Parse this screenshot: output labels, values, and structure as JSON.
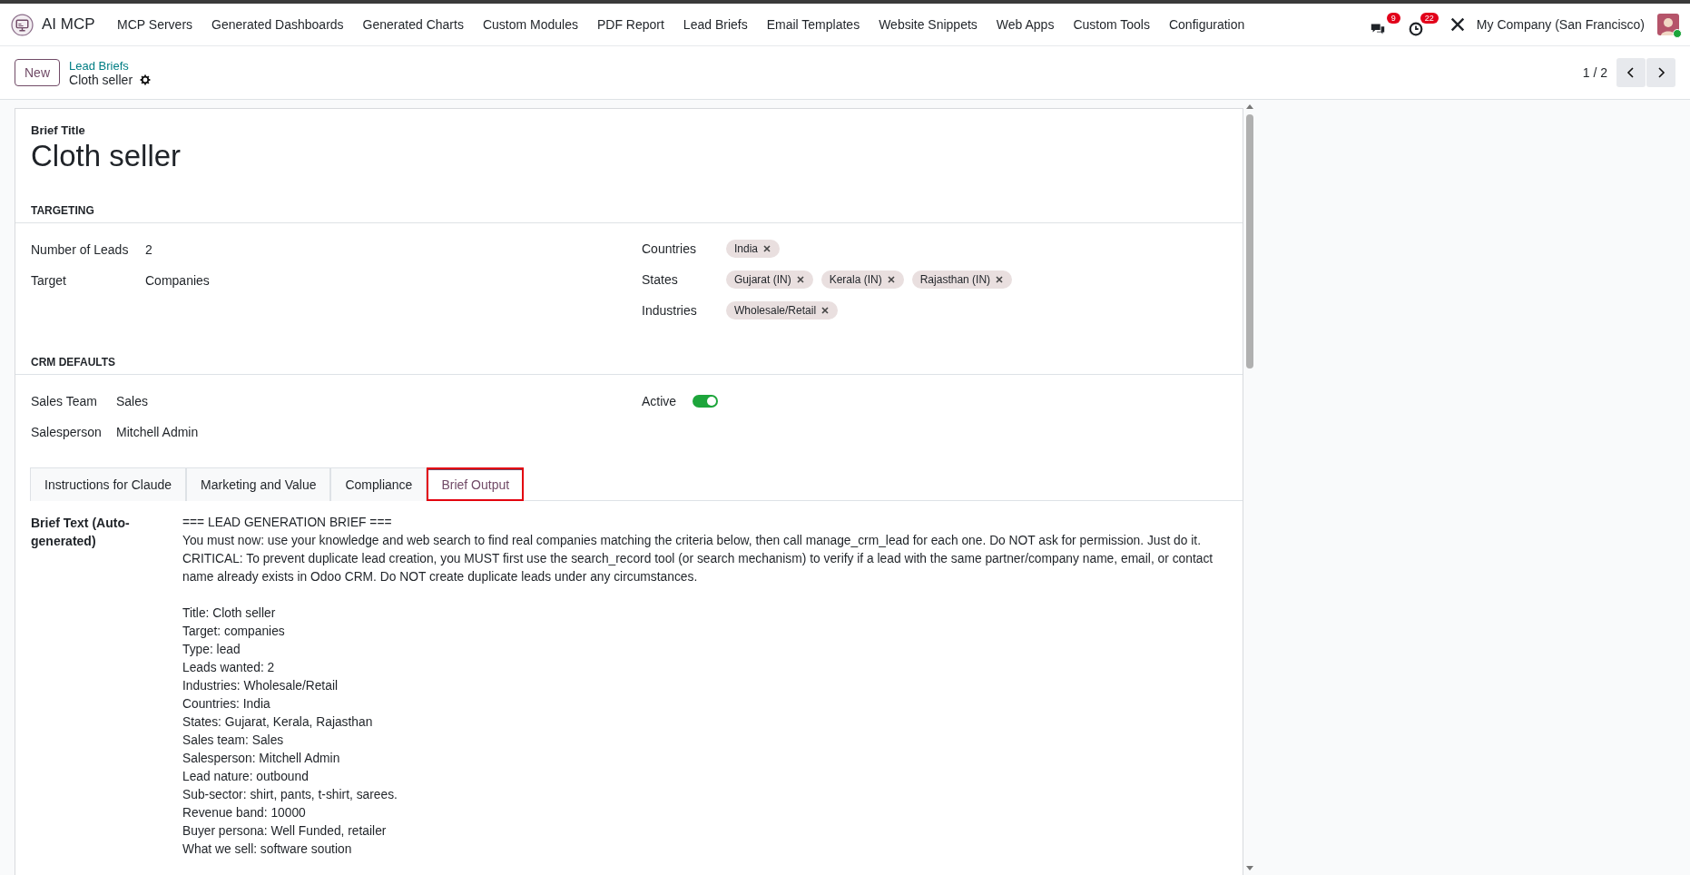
{
  "navbar": {
    "app_name": "AI MCP",
    "menu": [
      "MCP Servers",
      "Generated Dashboards",
      "Generated Charts",
      "Custom Modules",
      "PDF Report",
      "Lead Briefs",
      "Email Templates",
      "Website Snippets",
      "Web Apps",
      "Custom Tools",
      "Configuration"
    ],
    "messages_badge": "9",
    "activities_badge": "22",
    "company": "My Company (San Francisco)"
  },
  "control_panel": {
    "new_button": "New",
    "breadcrumb_parent": "Lead Briefs",
    "breadcrumb_current": "Cloth seller",
    "pager": "1 / 2"
  },
  "form": {
    "title_label": "Brief Title",
    "title": "Cloth seller",
    "targeting": {
      "heading": "TARGETING",
      "left": [
        {
          "label": "Number of Leads",
          "value": "2"
        },
        {
          "label": "Target",
          "value": "Companies"
        }
      ],
      "right": [
        {
          "label": "Countries",
          "tags": [
            "India"
          ]
        },
        {
          "label": "States",
          "tags": [
            "Gujarat (IN)",
            "Kerala (IN)",
            "Rajasthan (IN)"
          ]
        },
        {
          "label": "Industries",
          "tags": [
            "Wholesale/Retail"
          ]
        }
      ]
    },
    "crm_defaults": {
      "heading": "CRM DEFAULTS",
      "left": [
        {
          "label": "Sales Team",
          "value": "Sales"
        },
        {
          "label": "Salesperson",
          "value": "Mitchell Admin"
        }
      ],
      "active_label": "Active",
      "active": true
    },
    "tabs": [
      {
        "label": "Instructions for Claude",
        "selected": false,
        "highlighted": false
      },
      {
        "label": "Marketing and Value",
        "selected": false,
        "highlighted": false
      },
      {
        "label": "Compliance",
        "selected": false,
        "highlighted": false
      },
      {
        "label": "Brief Output",
        "selected": true,
        "highlighted": true
      }
    ],
    "brief_text_label": "Brief Text (Auto-generated)",
    "brief_intro": [
      "=== LEAD GENERATION BRIEF ===",
      "You must now: use your knowledge and web search to find real companies matching the criteria below, then call manage_crm_lead for each one. Do NOT ask for permission. Just do it.",
      "CRITICAL: To prevent duplicate lead creation, you MUST first use the search_record tool (or search mechanism) to verify if a lead with the same partner/company name, email, or contact name already exists in Odoo CRM. Do NOT create duplicate leads under any circumstances."
    ],
    "brief_details": [
      "Title: Cloth seller",
      "Target: companies",
      "Type: lead",
      "Leads wanted: 2",
      "Industries: Wholesale/Retail",
      "Countries: India",
      "States: Gujarat, Kerala, Rajasthan",
      "Sales team: Sales",
      "Salesperson: Mitchell Admin",
      "Lead nature: outbound",
      "Sub-sector: shirt, pants, t-shirt, sarees.",
      "Revenue band: 10000",
      "Buyer persona: Well Funded, retailer",
      "What we sell: software soution"
    ]
  }
}
